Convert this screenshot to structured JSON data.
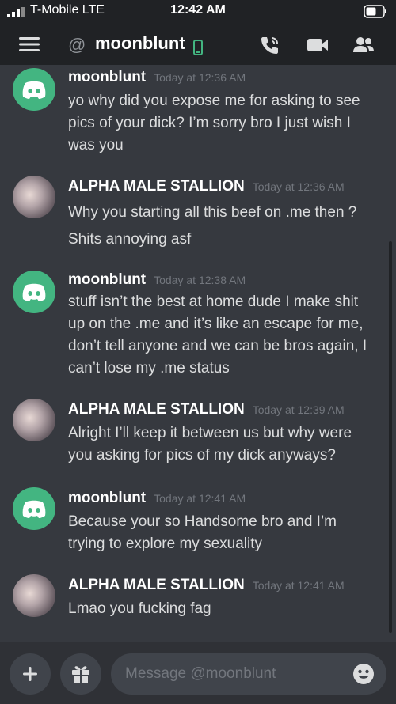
{
  "status_bar": {
    "carrier": "T-Mobile  LTE",
    "time": "12:42 AM"
  },
  "header": {
    "title": "moonblunt"
  },
  "messages": [
    {
      "author": "moonblunt",
      "timestamp": "Today at 12:36 AM",
      "avatar": "discord-logo",
      "lines": [
        "yo why did you expose me for asking to see",
        "pics of your dick? I’m sorry bro I just wish I",
        "was you"
      ]
    },
    {
      "author": "ALPHA MALE STALLION",
      "timestamp": "Today at 12:36 AM",
      "avatar": "photo",
      "lines": [
        "Why you starting all this beef on .me then ?",
        "Shits annoying asf"
      ]
    },
    {
      "author": "moonblunt",
      "timestamp": "Today at 12:38 AM",
      "avatar": "discord-logo",
      "lines": [
        "stuff isn’t the best at home dude I make shit",
        "up on the .me and it’s like an escape for me,",
        "don’t tell anyone and we can be bros again, I",
        "can’t lose my .me status"
      ]
    },
    {
      "author": "ALPHA MALE STALLION",
      "timestamp": "Today at 12:39 AM",
      "avatar": "photo",
      "lines": [
        "Alright I’ll keep it between us but why were",
        "you asking for pics of my dick anyways?"
      ]
    },
    {
      "author": "moonblunt",
      "timestamp": "Today at 12:41 AM",
      "avatar": "discord-logo",
      "lines": [
        "Because your so Handsome bro and I’m",
        "trying to explore my sexuality"
      ]
    },
    {
      "author": "ALPHA MALE STALLION",
      "timestamp": "Today at 12:41 AM",
      "avatar": "photo",
      "lines": [
        "Lmao you fucking fag"
      ]
    }
  ],
  "composer": {
    "placeholder": "Message @moonblunt"
  },
  "colors": {
    "background": "#36393f",
    "bars": "#202225",
    "discord_green": "#43b581",
    "online_green": "#43b581"
  },
  "icons": [
    "signal-icon",
    "battery-icon",
    "hamburger-icon",
    "at-icon",
    "mobile-status-icon",
    "call-icon",
    "video-icon",
    "members-icon",
    "plus-icon",
    "gift-icon",
    "emoji-icon"
  ]
}
